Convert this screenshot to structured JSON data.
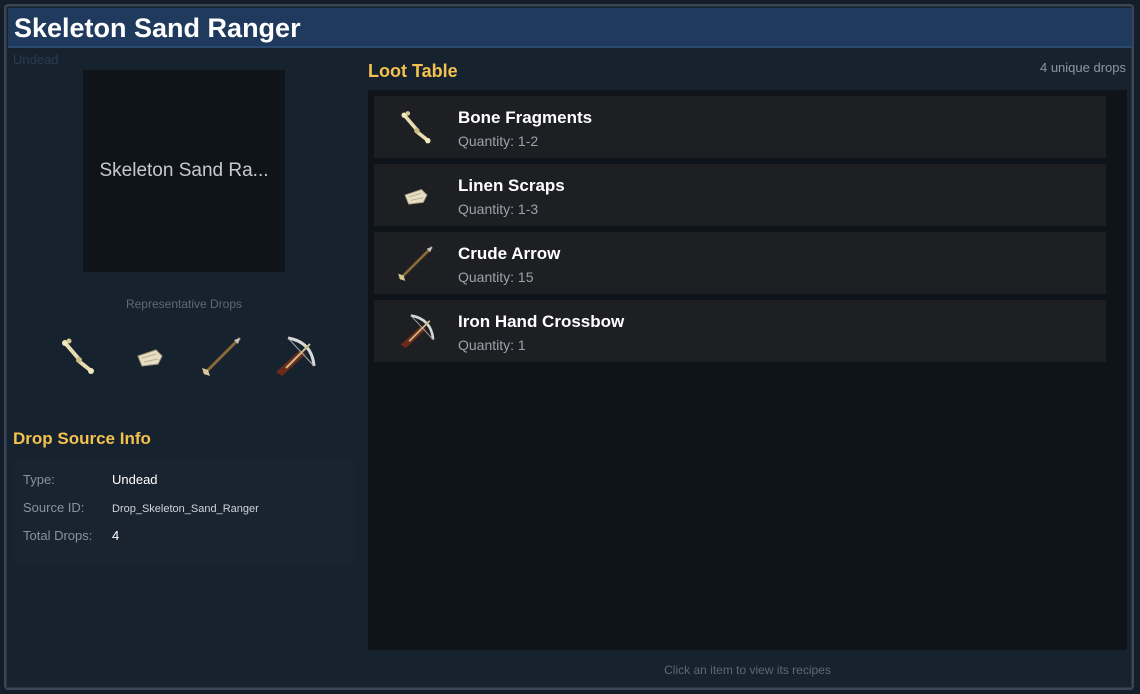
{
  "header": {
    "title": "Skeleton Sand Ranger",
    "subtype": "Undead"
  },
  "portrait": {
    "label": "Skeleton Sand Ranger",
    "label_display": "Skeleton Sand Ra..."
  },
  "representative_drops": {
    "label": "Representative Drops",
    "icons": [
      "bone-fragments-icon",
      "linen-scraps-icon",
      "crude-arrow-icon",
      "iron-hand-crossbow-icon"
    ]
  },
  "drop_source_info": {
    "title": "Drop Source Info",
    "rows": [
      {
        "key": "Type:",
        "value": "Undead"
      },
      {
        "key": "Source ID:",
        "value": "Drop_Skeleton_Sand_Ranger"
      },
      {
        "key": "Total Drops:",
        "value": "4"
      }
    ]
  },
  "loot_table": {
    "title": "Loot Table",
    "count_label": "4 unique drops",
    "items": [
      {
        "name": "Bone Fragments",
        "quantity": "Quantity: 1-2",
        "icon": "bone-fragments-icon"
      },
      {
        "name": "Linen Scraps",
        "quantity": "Quantity: 1-3",
        "icon": "linen-scraps-icon"
      },
      {
        "name": "Crude Arrow",
        "quantity": "Quantity: 15",
        "icon": "crude-arrow-icon"
      },
      {
        "name": "Iron Hand Crossbow",
        "quantity": "Quantity: 1",
        "icon": "iron-hand-crossbow-icon"
      }
    ]
  },
  "footer": {
    "hint": "Click an item to view its recipes"
  },
  "colors": {
    "accent": "#f2c14e",
    "titlebar": "#1f3a5c",
    "background": "#17222f",
    "panel": "#0f141b",
    "row": "#1e1f22"
  }
}
